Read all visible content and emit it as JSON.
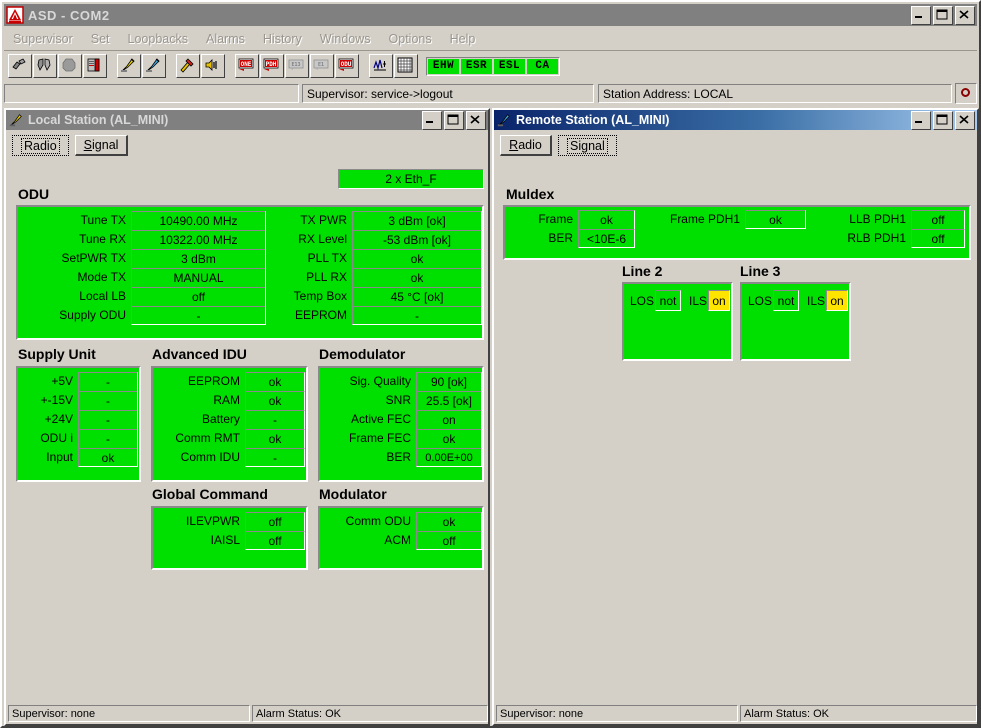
{
  "app": {
    "title": "ASD - COM2",
    "logo_icon": "alcatel-logo-icon",
    "window_buttons": {
      "minimize": "_",
      "maximize": "□",
      "close": "✕"
    }
  },
  "menubar": {
    "items": [
      {
        "label": "Supervisor",
        "name": "menu-supervisor"
      },
      {
        "label": "Set",
        "name": "menu-set"
      },
      {
        "label": "Loopbacks",
        "name": "menu-loopbacks"
      },
      {
        "label": "Alarms",
        "name": "menu-alarms"
      },
      {
        "label": "History",
        "name": "menu-history"
      },
      {
        "label": "Windows",
        "name": "menu-windows"
      },
      {
        "label": "Options",
        "name": "menu-options"
      },
      {
        "label": "Help",
        "name": "menu-help"
      }
    ]
  },
  "toolbar": {
    "buttons": [
      {
        "icon": "broken-link-icon"
      },
      {
        "icon": "broken-heart-icon"
      },
      {
        "icon": "grey-octagon-icon"
      },
      {
        "icon": "book-red-icon"
      },
      {
        "icon": "local-station-yellow-icon"
      },
      {
        "icon": "remote-station-blue-icon"
      },
      {
        "icon": "tools-hammer-icon"
      },
      {
        "icon": "speaker-alarm-icon"
      },
      {
        "icon": "one-red-icon"
      },
      {
        "icon": "pdh-red-icon"
      },
      {
        "icon": "e13-grey-icon"
      },
      {
        "icon": "e1-grey-icon"
      },
      {
        "icon": "odu-red-icon"
      },
      {
        "icon": "signal-graph-icon"
      },
      {
        "icon": "grid-matrix-icon"
      }
    ],
    "leds": [
      {
        "label": "EHW",
        "color": "#00e000"
      },
      {
        "label": "ESR",
        "color": "#00e000"
      },
      {
        "label": "ESL",
        "color": "#00e000"
      },
      {
        "label": "CA",
        "color": "#00e000"
      }
    ]
  },
  "status_row": {
    "blank": "",
    "supervisor": "Supervisor: service->logout",
    "station_address": "Station Address: LOCAL",
    "indicator_icon": "red-ring-indicator-icon"
  },
  "local_window": {
    "title": "Local Station (AL_MINI)",
    "title_icon": "local-station-yellow-icon",
    "active": false,
    "tabs": [
      {
        "label": "Radio",
        "selected": true
      },
      {
        "label": "Signal",
        "selected": false
      }
    ],
    "iface_badge": "2 x Eth_F",
    "odu": {
      "heading": "ODU",
      "left": [
        {
          "label": "Tune TX",
          "value": "10490.00 MHz"
        },
        {
          "label": "Tune RX",
          "value": "10322.00 MHz"
        },
        {
          "label": "SetPWR TX",
          "value": "3 dBm"
        },
        {
          "label": "Mode TX",
          "value": "MANUAL"
        },
        {
          "label": "Local LB",
          "value": "off"
        },
        {
          "label": "Supply ODU",
          "value": "-"
        }
      ],
      "right": [
        {
          "label": "TX PWR",
          "value": "3 dBm [ok]"
        },
        {
          "label": "RX Level",
          "value": "-53 dBm [ok]"
        },
        {
          "label": "PLL TX",
          "value": "ok"
        },
        {
          "label": "PLL RX",
          "value": "ok"
        },
        {
          "label": "Temp Box",
          "value": "45 °C [ok]"
        },
        {
          "label": "EEPROM",
          "value": "-"
        }
      ]
    },
    "supply_unit": {
      "heading": "Supply Unit",
      "rows": [
        {
          "label": "+5V",
          "value": "-"
        },
        {
          "label": "+-15V",
          "value": "-"
        },
        {
          "label": "+24V",
          "value": "-"
        },
        {
          "label": "ODU i",
          "value": "-"
        },
        {
          "label": "Input",
          "value": "ok"
        }
      ]
    },
    "advanced_idu": {
      "heading": "Advanced IDU",
      "rows": [
        {
          "label": "EEPROM",
          "value": "ok"
        },
        {
          "label": "RAM",
          "value": "ok"
        },
        {
          "label": "Battery",
          "value": "-"
        },
        {
          "label": "Comm RMT",
          "value": "ok"
        },
        {
          "label": "Comm IDU",
          "value": "-"
        }
      ]
    },
    "demodulator": {
      "heading": "Demodulator",
      "rows": [
        {
          "label": "Sig. Quality",
          "value": "90 [ok]"
        },
        {
          "label": "SNR",
          "value": "25.5 [ok]"
        },
        {
          "label": "Active FEC",
          "value": "on"
        },
        {
          "label": "Frame FEC",
          "value": "ok"
        },
        {
          "label": "BER",
          "value": "0.00E+00"
        }
      ]
    },
    "global_command": {
      "heading": "Global Command",
      "rows": [
        {
          "label": "ILEVPWR",
          "value": "off"
        },
        {
          "label": "IAISL",
          "value": "off"
        }
      ]
    },
    "modulator": {
      "heading": "Modulator",
      "rows": [
        {
          "label": "Comm ODU",
          "value": "ok"
        },
        {
          "label": "ACM",
          "value": "off"
        }
      ]
    },
    "status": {
      "supervisor": "Supervisor: none",
      "alarm": "Alarm Status: OK"
    }
  },
  "remote_window": {
    "title": "Remote Station (AL_MINI)",
    "title_icon": "remote-station-blue-icon",
    "active": true,
    "tabs": [
      {
        "label": "Radio",
        "selected": false
      },
      {
        "label": "Signal",
        "selected": true
      }
    ],
    "muldex": {
      "heading": "Muldex",
      "col1": [
        {
          "label": "Frame",
          "value": "ok"
        },
        {
          "label": "BER",
          "value": "<10E-6"
        }
      ],
      "col2": [
        {
          "label": "Frame PDH1",
          "value": "ok"
        }
      ],
      "col3": [
        {
          "label": "LLB PDH1",
          "value": "off"
        },
        {
          "label": "RLB PDH1",
          "value": "off"
        }
      ]
    },
    "lines": [
      {
        "heading": "Line 2",
        "items": [
          {
            "label": "LOS",
            "value": "not",
            "highlight": false
          },
          {
            "label": "ILS",
            "value": "on",
            "highlight": true
          }
        ]
      },
      {
        "heading": "Line 3",
        "items": [
          {
            "label": "LOS",
            "value": "not",
            "highlight": false
          },
          {
            "label": "ILS",
            "value": "on",
            "highlight": true
          }
        ]
      }
    ],
    "status": {
      "supervisor": "Supervisor: none",
      "alarm": "Alarm Status: OK"
    }
  },
  "colors": {
    "green_panel": "#00e000",
    "yellow_alarm": "#ffe400",
    "face": "#d4d0c8",
    "title_active": "#0a246a"
  }
}
